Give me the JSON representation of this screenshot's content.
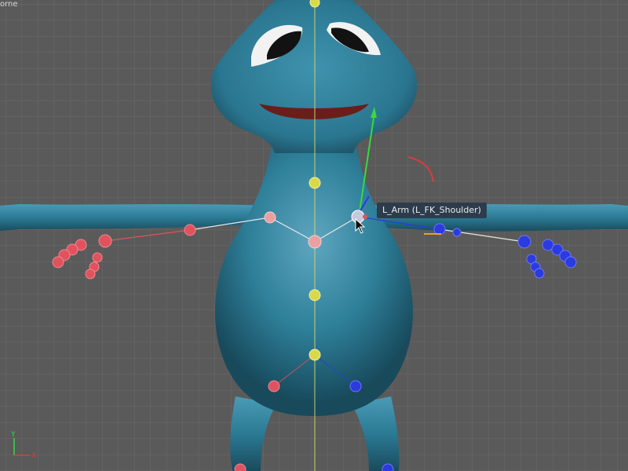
{
  "viewport": {
    "camera_label": "orne",
    "tooltip": {
      "label": "L_Arm (L_FK_Shoulder)"
    },
    "axis": {
      "y_label": "Y",
      "x_label": "X"
    }
  },
  "colors": {
    "background": "#5a5a5a",
    "grid": "#6b6b6b",
    "body": "#2c7d98",
    "body_dark": "#1b5469",
    "left_controls": "#e0535e",
    "right_controls": "#2b3be0",
    "spine_controls": "#d9d84a",
    "axis_y": "#39d93c",
    "axis_x": "#d93c3c"
  },
  "icons": [
    "arrow-cursor-icon",
    "move-gizmo-icon",
    "rotate-gizmo-icon",
    "xy-axis-icon"
  ]
}
